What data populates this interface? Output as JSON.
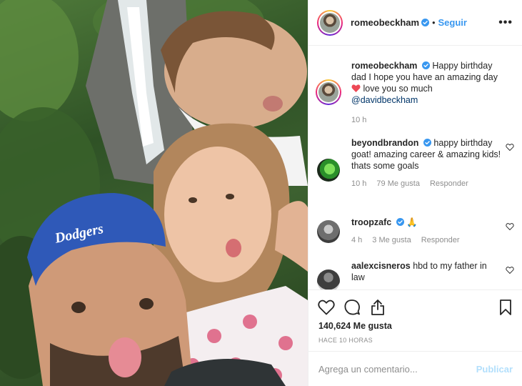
{
  "post": {
    "author": "romeobeckham",
    "separator": "•",
    "follow_label": "Seguir",
    "more_label": "•••",
    "caption": {
      "user": "romeobeckham",
      "text_before": "Happy birthday dad I hope you have an amazing day",
      "text_after": "love you so much",
      "mention": "@davidbeckham",
      "time": "10 h"
    }
  },
  "comments": [
    {
      "user": "beyondbrandon",
      "verified": true,
      "text": "happy birthday goat! amazing career & amazing kids! thats some goals",
      "time": "10 h",
      "likes": "79 Me gusta",
      "reply": "Responder"
    },
    {
      "user": "troopzafc",
      "verified": true,
      "text": "🙏",
      "time": "4 h",
      "likes": "3 Me gusta",
      "reply": "Responder"
    },
    {
      "user": "aalexcisneros",
      "verified": false,
      "text": "hbd to my father in law"
    }
  ],
  "actions": {
    "icons": [
      "heart-outline-icon",
      "comment-icon",
      "share-icon",
      "bookmark-icon"
    ],
    "likes_count": "140,624 Me gusta",
    "timestamp": "HACE 10 HORAS"
  },
  "add_comment": {
    "placeholder": "Agrega un comentario...",
    "publish_label": "Publicar"
  },
  "photo": {
    "cap_text": "Dodgers"
  },
  "colors": {
    "link": "#3897f0",
    "verified": "#3897f0",
    "heart": "#ed4956",
    "muted": "#8e8e8e",
    "publish_disabled": "#b2dffc"
  }
}
